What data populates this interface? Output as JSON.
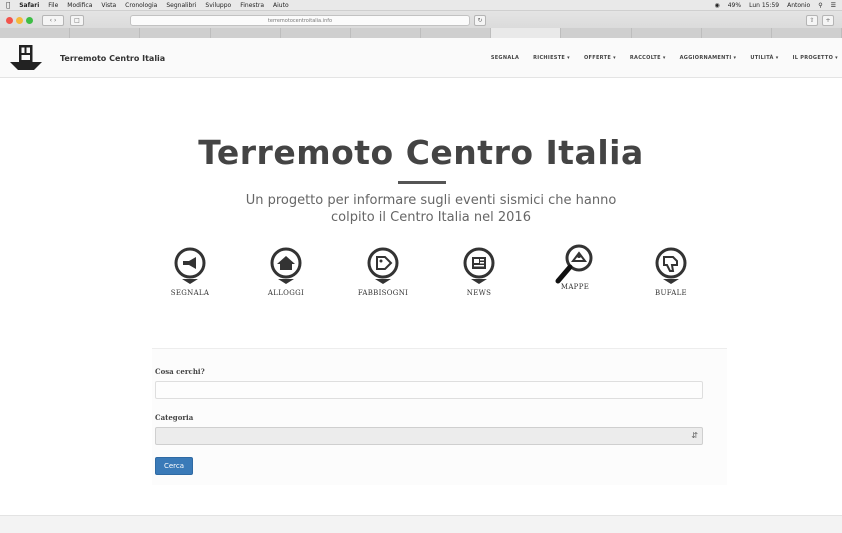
{
  "menubar": {
    "items": [
      "Safari",
      "File",
      "Modifica",
      "Vista",
      "Cronologia",
      "Segnalibri",
      "Sviluppo",
      "Finestra",
      "Aiuto"
    ],
    "status": [
      "49%",
      "Lun 15:59",
      "Antonio"
    ]
  },
  "browser": {
    "address": "terremotocentroitalia.info",
    "tabs": [
      "",
      "",
      "",
      "",
      "",
      "",
      "",
      "",
      "",
      "",
      "",
      ""
    ],
    "active_tab": 7
  },
  "site": {
    "brand": "Terremoto Centro Italia",
    "nav": [
      "SEGNALA",
      "RICHIESTE ▾",
      "OFFERTE ▾",
      "RACCOLTE ▾",
      "AGGIORNAMENTI ▾",
      "UTILITÀ ▾",
      "IL PROGETTO ▾"
    ]
  },
  "hero": {
    "title": "Terremoto Centro Italia",
    "subtitle_line1": "Un progetto per informare sugli eventi sismici che hanno",
    "subtitle_line2": "colpito il Centro Italia nel 2016"
  },
  "icons": [
    {
      "label": "SEGNALA",
      "icon": "megaphone-icon"
    },
    {
      "label": "ALLOGGI",
      "icon": "house-icon"
    },
    {
      "label": "FABBISOGNI",
      "icon": "tag-icon"
    },
    {
      "label": "NEWS",
      "icon": "newspaper-icon"
    },
    {
      "label": "MAPPE",
      "icon": "map-search-icon"
    },
    {
      "label": "BUFALE",
      "icon": "thumbs-down-icon"
    }
  ],
  "form": {
    "query_label": "Cosa cerchi?",
    "query_value": "",
    "category_label": "Categoria",
    "category_value": "",
    "submit_label": "Cerca"
  },
  "colors": {
    "accent": "#3a7ab8",
    "title": "#444444",
    "icon": "#333333"
  }
}
